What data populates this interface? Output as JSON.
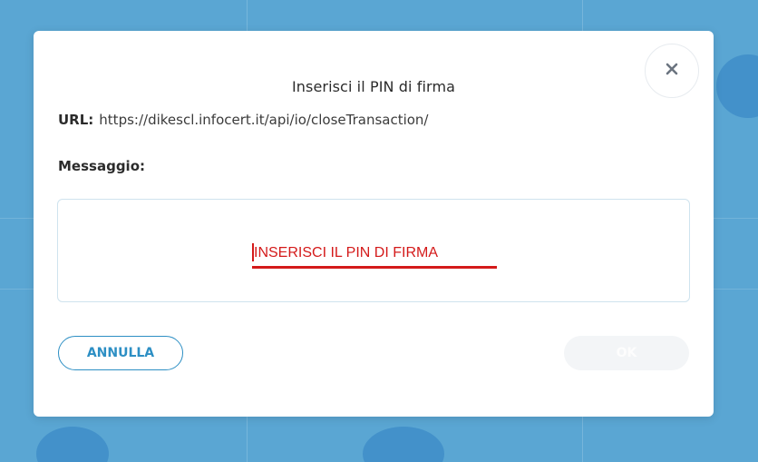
{
  "dialog": {
    "title": "Inserisci il PIN di firma",
    "url_label": "URL:",
    "url_value": "https://dikescl.infocert.it/api/io/closeTransaction/",
    "message_label": "Messaggio:",
    "pin_placeholder": "INSERISCI IL PIN DI FIRMA",
    "pin_value": "",
    "cancel_label": "ANNULLA",
    "ok_label": "OK",
    "close_icon": "close-icon"
  },
  "colors": {
    "backdrop": "#5aa6d3",
    "accent": "#2d8fc4",
    "pin_red": "#d41a1a",
    "ok_disabled_bg": "#f3f5f7"
  }
}
